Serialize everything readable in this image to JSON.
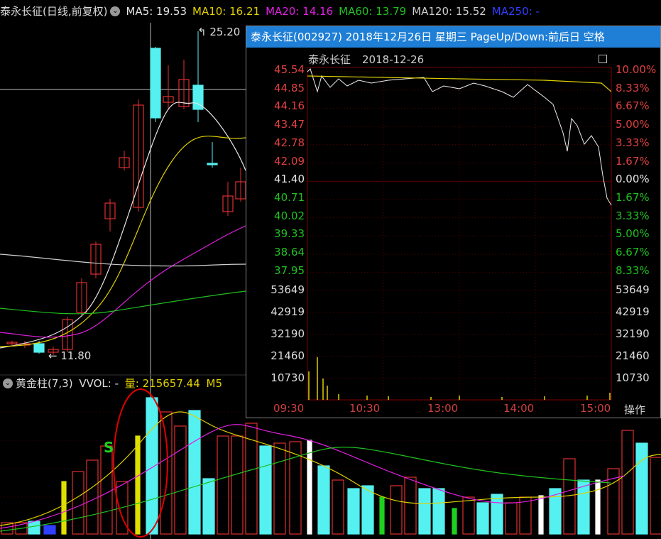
{
  "header": {
    "stock_label": "泰永长征(日线,前复权)",
    "indicators": [
      {
        "label": "MA5: 19.53",
        "color": "#e6e6e6"
      },
      {
        "label": "MA10: 16.21",
        "color": "#e0d000"
      },
      {
        "label": "MA20: 14.16",
        "color": "#e020e0"
      },
      {
        "label": "MA60: 13.79",
        "color": "#20c020"
      },
      {
        "label": "MA120: 15.52",
        "color": "#cfcfcf"
      },
      {
        "label": "MA250: -",
        "color": "#3040ff"
      }
    ]
  },
  "main_chart": {
    "price_high_label": "25.20",
    "price_low_label": "11.80",
    "signal_label": "S"
  },
  "volume_header": {
    "indicator": "黄金柱(7,3)",
    "vvol": "VVOL: -",
    "value": "量: 215657.44",
    "suffix": "M5"
  },
  "popup": {
    "title": "泰永长征(002927) 2018年12月26日 星期三 PageUp/Down:前后日 空格",
    "stock_name": "泰永长征",
    "date": "2018-12-26",
    "price_ticks": [
      {
        "value": "45.54",
        "color": "#e04040"
      },
      {
        "value": "44.85",
        "color": "#e04040"
      },
      {
        "value": "44.16",
        "color": "#e04040"
      },
      {
        "value": "43.47",
        "color": "#e04040"
      },
      {
        "value": "42.78",
        "color": "#e04040"
      },
      {
        "value": "42.09",
        "color": "#e04040"
      },
      {
        "value": "41.40",
        "color": "#e6e6e6"
      },
      {
        "value": "40.71",
        "color": "#20c020"
      },
      {
        "value": "40.02",
        "color": "#20c020"
      },
      {
        "value": "39.33",
        "color": "#20c020"
      },
      {
        "value": "38.64",
        "color": "#20c020"
      },
      {
        "value": "37.95",
        "color": "#20c020"
      }
    ],
    "pct_ticks": [
      {
        "value": "10.00%",
        "color": "#e04040"
      },
      {
        "value": "8.33%",
        "color": "#e04040"
      },
      {
        "value": "6.67%",
        "color": "#e04040"
      },
      {
        "value": "5.00%",
        "color": "#e04040"
      },
      {
        "value": "3.33%",
        "color": "#e04040"
      },
      {
        "value": "1.67%",
        "color": "#e04040"
      },
      {
        "value": "0.00%",
        "color": "#e6e6e6"
      },
      {
        "value": "1.67%",
        "color": "#20c020"
      },
      {
        "value": "3.33%",
        "color": "#20c020"
      },
      {
        "value": "5.00%",
        "color": "#20c020"
      },
      {
        "value": "6.67%",
        "color": "#20c020"
      },
      {
        "value": "8.33%",
        "color": "#20c020"
      }
    ],
    "volume_ticks": [
      "53649",
      "42919",
      "32190",
      "21460",
      "10730"
    ],
    "time_ticks": [
      "09:30",
      "10:30",
      "13:00",
      "14:00",
      "15:00"
    ],
    "operate_label": "操作"
  }
}
